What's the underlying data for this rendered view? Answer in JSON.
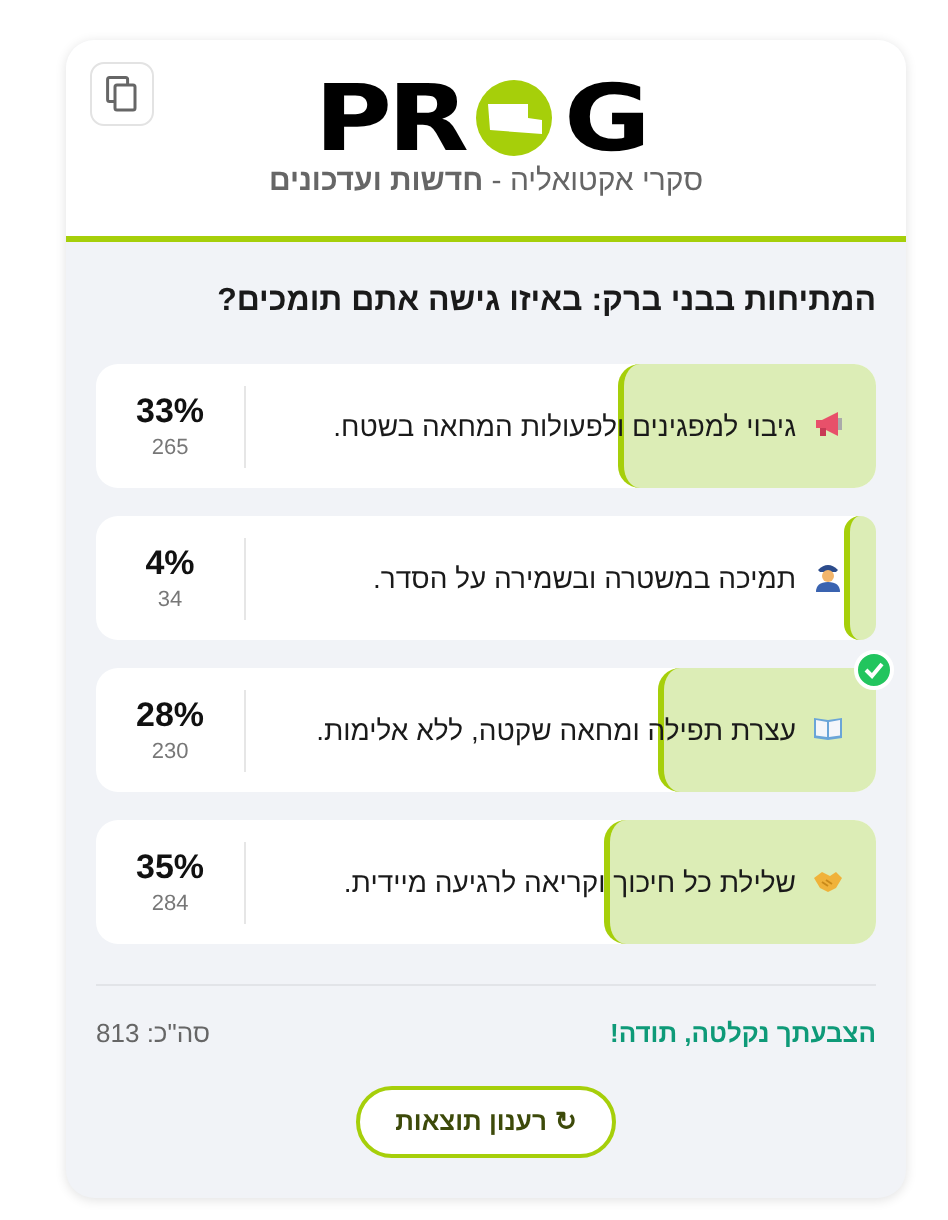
{
  "logo": {
    "text_start": "PR",
    "text_end": "G",
    "tagline": "סקרי אקטואליה - **חדשות ועדכונים**"
  },
  "question": "המתיחות בבני ברק: באיזו גישה אתם תומכים?",
  "options": [
    {
      "kind": "megaphone",
      "text": "גיבוי למפגינים ולפעולות המחאה בשטח.",
      "percent": "33%",
      "votes": "265",
      "level": 0.33,
      "selected": false
    },
    {
      "kind": "officer",
      "text": "תמיכה במשטרה ובשמירה על הסדר.",
      "percent": "4%",
      "votes": "34",
      "level": 0.04,
      "selected": false
    },
    {
      "kind": "book",
      "text": "עצרת תפילה ומחאה שקטה, ללא אלימות.",
      "percent": "28%",
      "votes": "230",
      "level": 0.28,
      "selected": true
    },
    {
      "kind": "handshake",
      "text": "שלילת כל חיכוך וקריאה לרגיעה מיידית.",
      "percent": "35%",
      "votes": "284",
      "level": 0.35,
      "selected": false
    }
  ],
  "footer": {
    "message": "הצבעתך נקלטה, תודה!",
    "total": "סה\"כ: 813"
  },
  "refresh_button": {
    "icon": "↻",
    "label": "רענון תוצאות"
  }
}
